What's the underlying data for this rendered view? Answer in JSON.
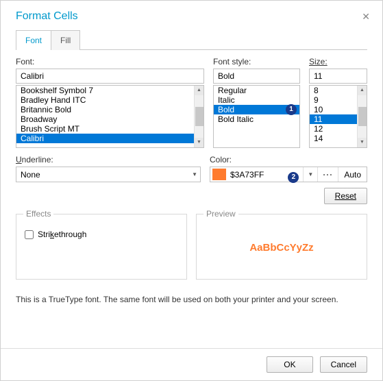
{
  "dialog": {
    "title": "Format Cells",
    "close": "✕"
  },
  "tabs": [
    {
      "label": "Font",
      "active": true
    },
    {
      "label": "Fill",
      "active": false
    }
  ],
  "labels": {
    "font": "Font:",
    "style": "Font style:",
    "size": "Size:",
    "underline": "Underline:",
    "color": "Color:",
    "effects": "Effects",
    "preview": "Preview",
    "strikethrough": "Strikethrough"
  },
  "font": {
    "value": "Calibri",
    "items": [
      "Bookshelf Symbol 7",
      "Bradley Hand ITC",
      "Britannic Bold",
      "Broadway",
      "Brush Script MT",
      "Calibri"
    ],
    "selected": "Calibri"
  },
  "style": {
    "value": "Bold",
    "items": [
      "Regular",
      "Italic",
      "Bold",
      "Bold Italic"
    ],
    "selected": "Bold",
    "badge": "1"
  },
  "size": {
    "value": "11",
    "items": [
      "8",
      "9",
      "10",
      "11",
      "12",
      "14"
    ],
    "selected": "11"
  },
  "underline": {
    "value": "None"
  },
  "color": {
    "swatch": "#ff7b2e",
    "value": "$3A73FF",
    "badge": "2",
    "auto": "Auto",
    "dots": "···"
  },
  "buttons": {
    "reset": "Reset",
    "ok": "OK",
    "cancel": "Cancel"
  },
  "preview": {
    "sample": "AaBbCcYyZz"
  },
  "footnote": "This is a TrueType font. The same font will be used on both your printer and your screen."
}
